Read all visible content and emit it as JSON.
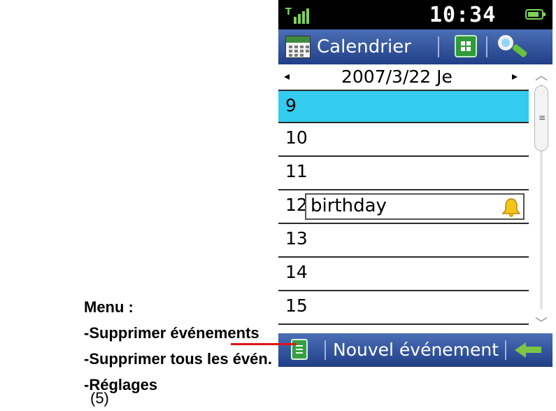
{
  "status_bar": {
    "time": "10:34",
    "battery_level": 0.85,
    "signal_label": "T"
  },
  "title_bar": {
    "title": "Calendrier"
  },
  "date_nav": {
    "date": "2007/3/22 Je"
  },
  "hours": [
    {
      "hour": "9",
      "selected": true,
      "event": ""
    },
    {
      "hour": "10",
      "selected": false,
      "event": ""
    },
    {
      "hour": "11",
      "selected": false,
      "event": ""
    },
    {
      "hour": "12",
      "selected": false,
      "event": "birthday"
    },
    {
      "hour": "13",
      "selected": false,
      "event": ""
    },
    {
      "hour": "14",
      "selected": false,
      "event": ""
    },
    {
      "hour": "15",
      "selected": false,
      "event": ""
    }
  ],
  "toolbar": {
    "new_event_label": "Nouvel événement"
  },
  "menu_caption": {
    "heading": "Menu :",
    "items": [
      "-Supprimer événements",
      "-Supprimer tous les évén.",
      "-Réglages"
    ]
  },
  "figure_number": "(5)",
  "colors": {
    "selected_row": "#33ccef",
    "bar_blue": "#203f87",
    "accent_green": "#7cc644",
    "callout_red": "#e01515"
  }
}
